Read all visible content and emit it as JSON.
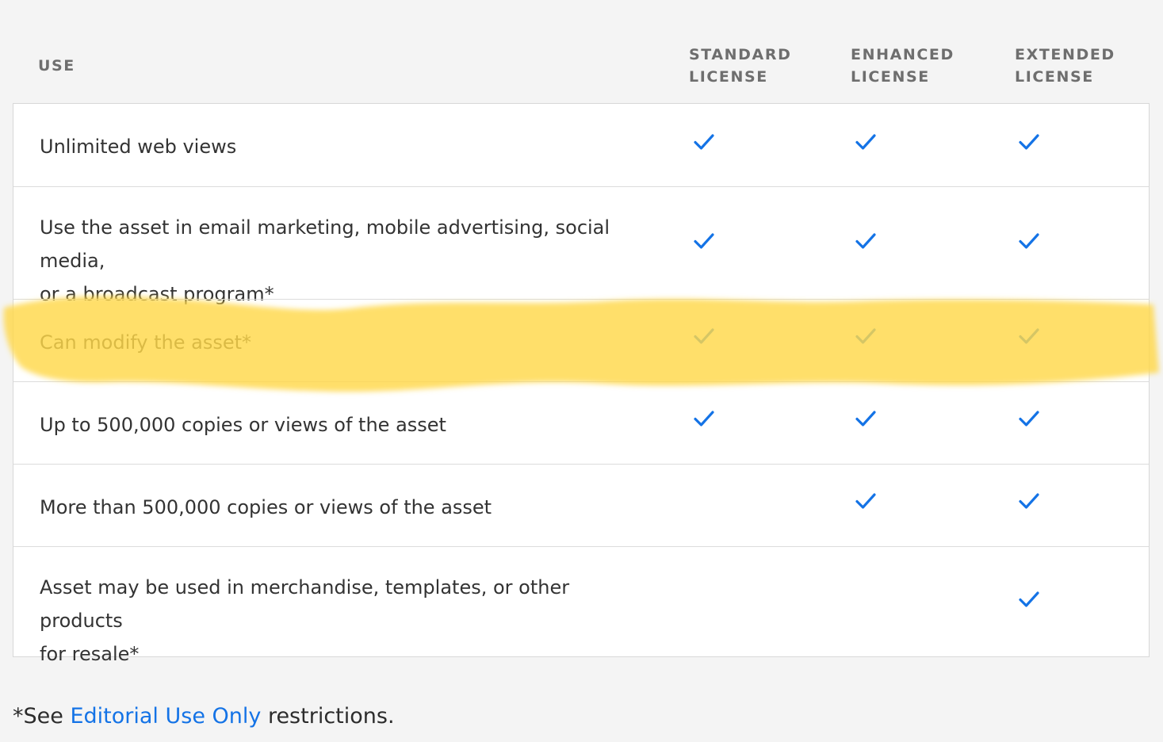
{
  "header": {
    "use": "USE",
    "standard": [
      "STANDARD",
      "LICENSE"
    ],
    "enhanced": [
      "ENHANCED",
      "LICENSE"
    ],
    "extended": [
      "EXTENDED",
      "LICENSE"
    ]
  },
  "rows": [
    {
      "text": [
        "Unlimited web views"
      ],
      "standard": true,
      "enhanced": true,
      "extended": true
    },
    {
      "text": [
        "Use the asset in email marketing, mobile advertising, social media,",
        "or a broadcast program*"
      ],
      "standard": true,
      "enhanced": true,
      "extended": true
    },
    {
      "text": [
        "Can modify the asset*"
      ],
      "standard": true,
      "enhanced": true,
      "extended": true
    },
    {
      "text": [
        "Up to 500,000 copies or views of the asset"
      ],
      "standard": true,
      "enhanced": true,
      "extended": true
    },
    {
      "text": [
        "More than 500,000 copies or views of the asset"
      ],
      "standard": false,
      "enhanced": true,
      "extended": true
    },
    {
      "text": [
        "Asset may be used in merchandise, templates, or other products",
        "for resale*"
      ],
      "standard": false,
      "enhanced": false,
      "extended": true
    }
  ],
  "footnote": {
    "prefix": "*See ",
    "link": "Editorial Use Only",
    "suffix": " restrictions."
  },
  "colors": {
    "check": "#1473e6",
    "highlight": "#ffd84a",
    "link": "#1473e6"
  },
  "icons": {
    "check": "checkmark-icon"
  }
}
